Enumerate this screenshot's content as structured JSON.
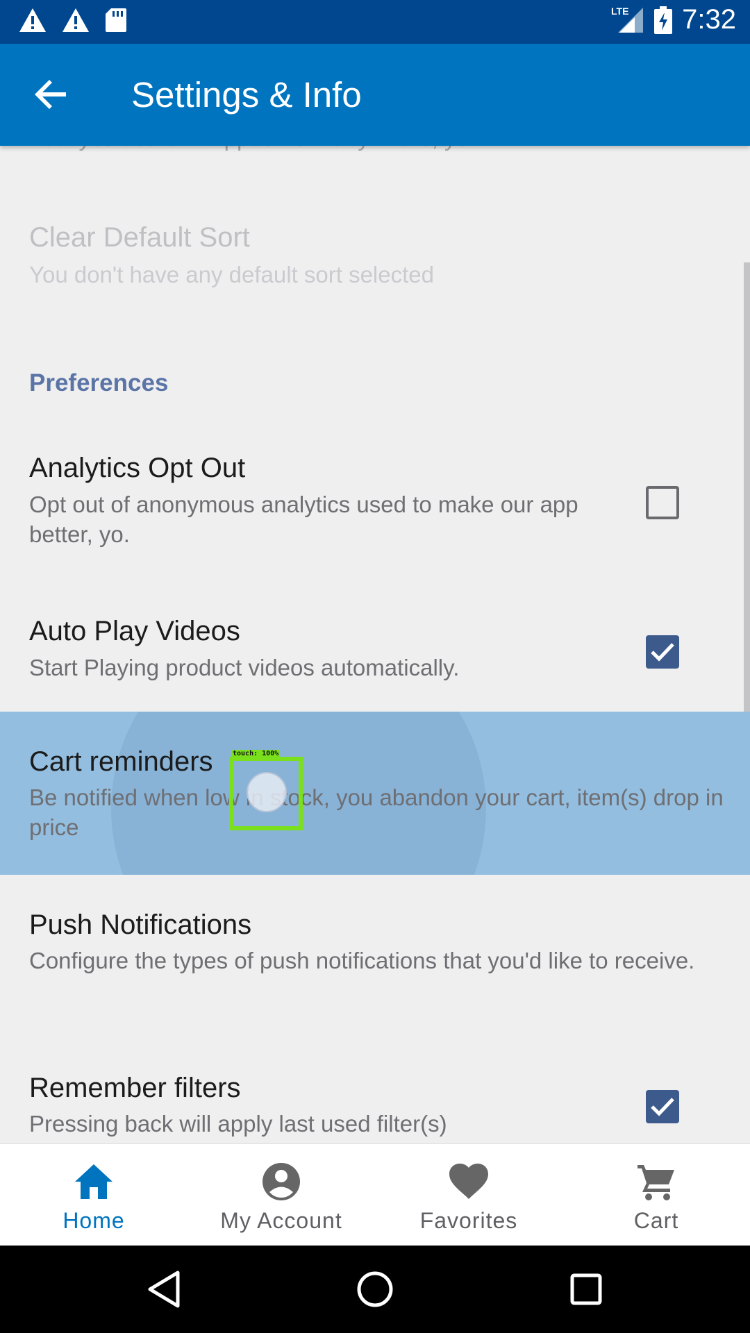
{
  "status_bar": {
    "time": "7:32",
    "network": "LTE"
  },
  "app_bar": {
    "title": "Settings & Info"
  },
  "settings": {
    "cut_text": "Lets you search Zappos from anywhere, yo.",
    "clear_sort": {
      "title": "Clear Default Sort",
      "subtitle": "You don't have any default sort selected"
    },
    "section": "Preferences",
    "analytics": {
      "title": "Analytics Opt Out",
      "subtitle": "Opt out of anonymous analytics used to make our app better, yo.",
      "checked": false
    },
    "autoplay": {
      "title": "Auto Play Videos",
      "subtitle": "Start Playing product videos automatically.",
      "checked": true
    },
    "cart_reminders": {
      "title": "Cart reminders",
      "subtitle": "Be notified when low in stock, you abandon your cart, item(s) drop in price"
    },
    "push": {
      "title": "Push Notifications",
      "subtitle": "Configure the types of push notifications that you'd like to receive."
    },
    "filters": {
      "title": "Remember filters",
      "subtitle": "Pressing back will apply last used filter(s)",
      "checked": true
    }
  },
  "touch_overlay": {
    "label": "touch: 100%"
  },
  "bottom_nav": {
    "items": [
      {
        "label": "Home",
        "icon": "home-icon",
        "active": true
      },
      {
        "label": "My Account",
        "icon": "account-icon",
        "active": false
      },
      {
        "label": "Favorites",
        "icon": "heart-icon",
        "active": false
      },
      {
        "label": "Cart",
        "icon": "cart-icon",
        "active": false
      }
    ]
  },
  "colors": {
    "status_bar": "#00478f",
    "app_bar": "#0074bf",
    "checkbox_checked": "#3c5a8c",
    "section_header": "#5b74a6",
    "highlight": "#93bedf"
  }
}
